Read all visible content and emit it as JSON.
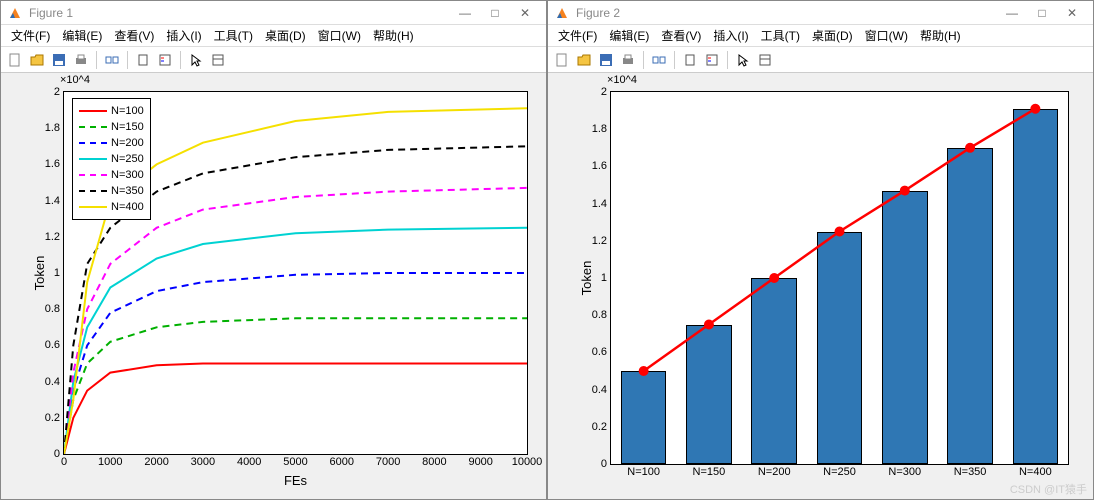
{
  "watermark": "CSDN @IT猿手",
  "windows": [
    {
      "title": "Figure 1",
      "min": "—",
      "max": "□",
      "close": "✕"
    },
    {
      "title": "Figure 2",
      "min": "—",
      "max": "□",
      "close": "✕"
    }
  ],
  "menu": [
    "文件(F)",
    "编辑(E)",
    "查看(V)",
    "插入(I)",
    "工具(T)",
    "桌面(D)",
    "窗口(W)",
    "帮助(H)"
  ],
  "chart_data": [
    {
      "type": "line",
      "title": "",
      "xlabel": "FEs",
      "ylabel": "Token",
      "xlim": [
        0,
        10000
      ],
      "ylim": [
        0,
        20000
      ],
      "y_exponent_label": "×10^4",
      "xticks": [
        0,
        1000,
        2000,
        3000,
        4000,
        5000,
        6000,
        7000,
        8000,
        9000,
        10000
      ],
      "yticks_raw": [
        0,
        2000,
        4000,
        6000,
        8000,
        10000,
        12000,
        14000,
        16000,
        18000,
        20000
      ],
      "ytick_labels": [
        "0",
        "0.2",
        "0.4",
        "0.6",
        "0.8",
        "1",
        "1.2",
        "1.4",
        "1.6",
        "1.8",
        "2"
      ],
      "series": [
        {
          "name": "N=100",
          "color": "#ff0000",
          "dash": "solid",
          "x": [
            0,
            200,
            500,
            1000,
            2000,
            3000,
            5000,
            7000,
            10000
          ],
          "y": [
            0,
            2000,
            3500,
            4500,
            4900,
            5000,
            5000,
            5000,
            5000
          ]
        },
        {
          "name": "N=150",
          "color": "#00b000",
          "dash": "dashed",
          "x": [
            0,
            200,
            500,
            1000,
            2000,
            3000,
            5000,
            7000,
            10000
          ],
          "y": [
            0,
            3000,
            5000,
            6200,
            7000,
            7300,
            7500,
            7500,
            7500
          ]
        },
        {
          "name": "N=200",
          "color": "#0000ff",
          "dash": "dashed",
          "x": [
            0,
            200,
            500,
            1000,
            2000,
            3000,
            5000,
            7000,
            10000
          ],
          "y": [
            0,
            3500,
            6000,
            7800,
            9000,
            9500,
            9900,
            10000,
            10000
          ]
        },
        {
          "name": "N=250",
          "color": "#00d2d2",
          "dash": "solid",
          "x": [
            0,
            200,
            500,
            1000,
            2000,
            3000,
            5000,
            7000,
            10000
          ],
          "y": [
            0,
            4000,
            7000,
            9200,
            10800,
            11600,
            12200,
            12400,
            12500
          ]
        },
        {
          "name": "N=300",
          "color": "#ff00ff",
          "dash": "dashed",
          "x": [
            0,
            200,
            500,
            1000,
            2000,
            3000,
            5000,
            7000,
            10000
          ],
          "y": [
            0,
            4500,
            8000,
            10500,
            12500,
            13500,
            14200,
            14500,
            14700
          ]
        },
        {
          "name": "N=350",
          "color": "#000000",
          "dash": "dashed",
          "x": [
            0,
            200,
            500,
            1000,
            2000,
            3000,
            5000,
            7000,
            10000
          ],
          "y": [
            0,
            6000,
            10500,
            12500,
            14500,
            15500,
            16400,
            16800,
            17000
          ]
        },
        {
          "name": "N=400",
          "color": "#f5e000",
          "dash": "solid",
          "x": [
            0,
            200,
            500,
            1000,
            2000,
            3000,
            5000,
            7000,
            10000
          ],
          "y": [
            0,
            3000,
            9500,
            14000,
            16000,
            17200,
            18400,
            18900,
            19100
          ]
        }
      ]
    },
    {
      "type": "bar",
      "title": "",
      "xlabel": "",
      "ylabel": "Token",
      "ylim": [
        0,
        20000
      ],
      "y_exponent_label": "×10^4",
      "ytick_labels": [
        "0",
        "0.2",
        "0.4",
        "0.6",
        "0.8",
        "1",
        "1.2",
        "1.4",
        "1.6",
        "1.8",
        "2"
      ],
      "yticks_raw": [
        0,
        2000,
        4000,
        6000,
        8000,
        10000,
        12000,
        14000,
        16000,
        18000,
        20000
      ],
      "categories": [
        "N=100",
        "N=150",
        "N=200",
        "N=250",
        "N=300",
        "N=350",
        "N=400"
      ],
      "values": [
        5000,
        7500,
        10000,
        12500,
        14700,
        17000,
        19100
      ],
      "overlay_line": {
        "color": "#ff0000",
        "marker": "#ff0000"
      }
    }
  ]
}
